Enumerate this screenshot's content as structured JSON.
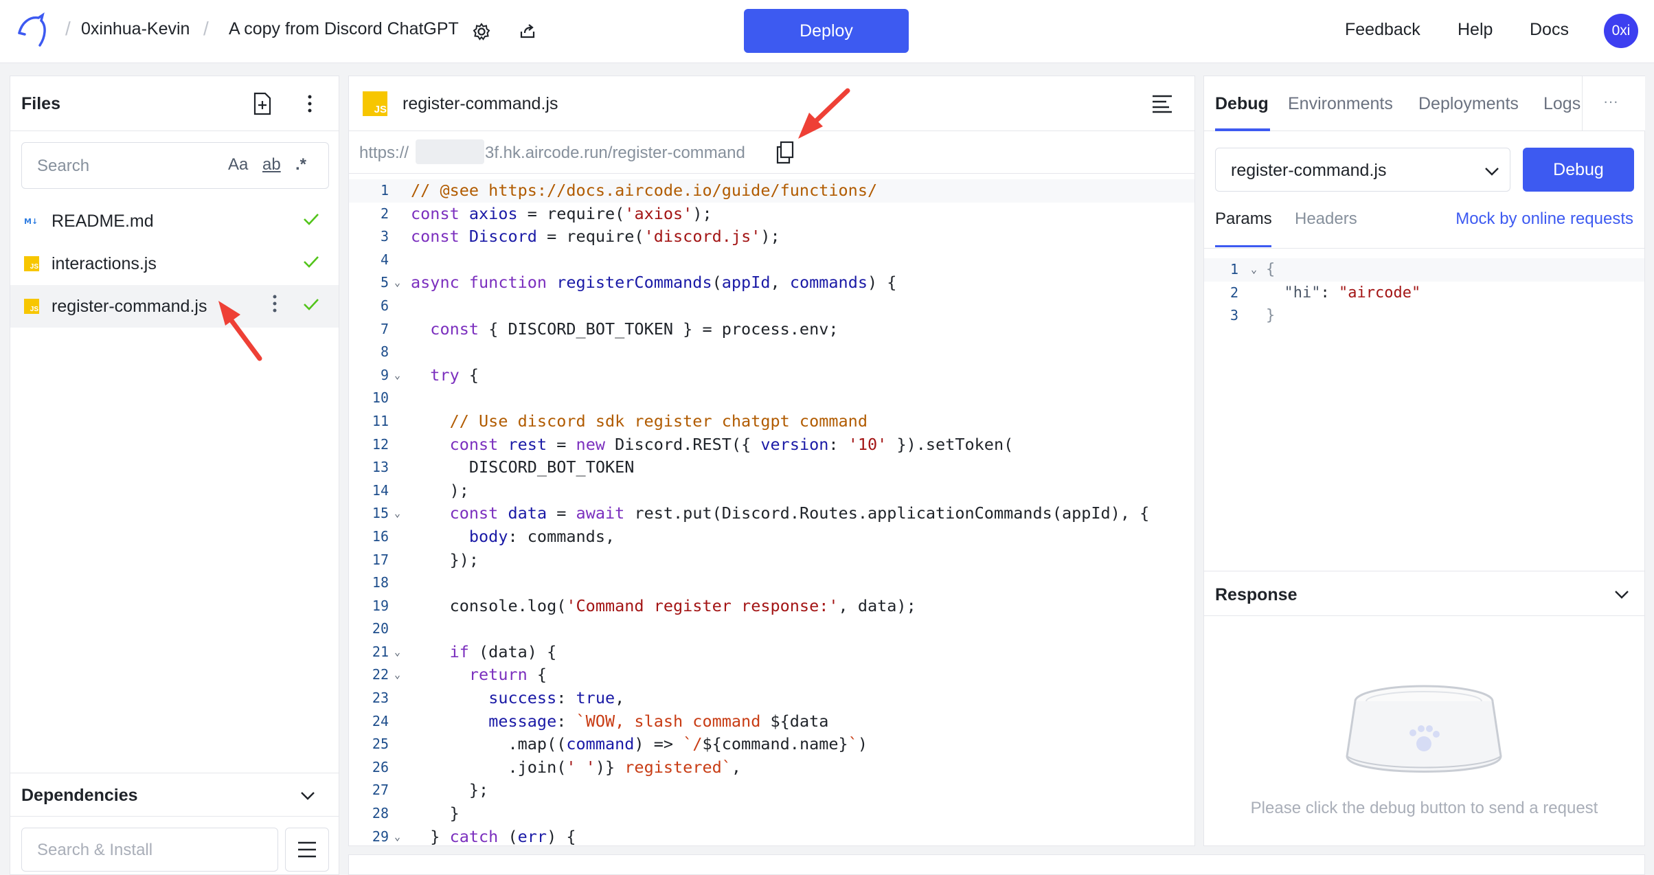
{
  "header": {
    "workspace": "0xinhua-Kevin",
    "project": "A copy from Discord ChatGPT",
    "deploy_label": "Deploy",
    "nav": [
      "Feedback",
      "Help",
      "Docs"
    ],
    "avatar": "0xi"
  },
  "files": {
    "title": "Files",
    "search_placeholder": "Search",
    "search_options": [
      "Aa",
      "ab",
      ".*"
    ],
    "items": [
      {
        "name": "README.md",
        "type": "markdown",
        "status": "saved"
      },
      {
        "name": "interactions.js",
        "type": "js",
        "status": "saved"
      },
      {
        "name": "register-command.js",
        "type": "js",
        "status": "saved",
        "active": true
      }
    ]
  },
  "dependencies": {
    "title": "Dependencies",
    "search_placeholder": "Search & Install"
  },
  "editor": {
    "filename": "register-command.js",
    "file_badge": "JS",
    "url_prefix": "https://",
    "url_suffix": "3f.hk.aircode.run/register-command",
    "lines": [
      "1",
      "2",
      "3",
      "4",
      "5",
      "6",
      "7",
      "8",
      "9",
      "10",
      "11",
      "12",
      "13",
      "14",
      "15",
      "16",
      "17",
      "18",
      "19",
      "20",
      "21",
      "22",
      "23",
      "24",
      "25",
      "26",
      "27",
      "28",
      "29"
    ]
  },
  "debug": {
    "tabs": [
      "Debug",
      "Environments",
      "Deployments",
      "Logs"
    ],
    "more": "···",
    "selected_file": "register-command.js",
    "debug_label": "Debug",
    "subtabs": [
      "Params",
      "Headers"
    ],
    "mock_link": "Mock by online requests",
    "params_lines": [
      "1",
      "2",
      "3"
    ],
    "response_title": "Response",
    "empty_message": "Please click the debug button to send a request"
  },
  "colors": {
    "accent": "#3d5af1",
    "success": "#52c41a",
    "annotation_arrow": "#ee4036",
    "js_badge": "#f7c600"
  }
}
